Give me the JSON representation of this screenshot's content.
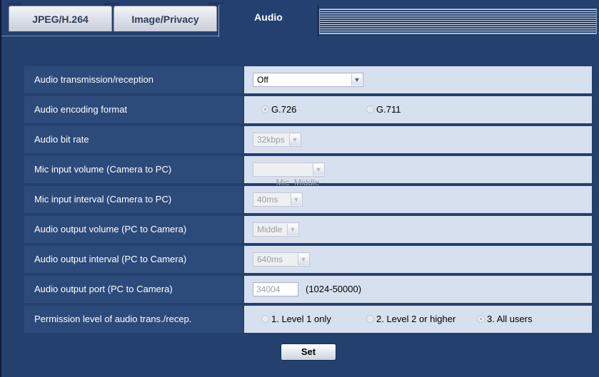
{
  "tabs": [
    {
      "label": "JPEG/H.264"
    },
    {
      "label": "Image/Privacy"
    },
    {
      "label": "Audio"
    }
  ],
  "rows": {
    "transmission": {
      "label": "Audio transmission/reception",
      "value": "Off"
    },
    "encoding": {
      "label": "Audio encoding format",
      "options": [
        "G.726",
        "G.711"
      ],
      "selected": "G.726"
    },
    "bitrate": {
      "label": "Audio bit rate",
      "value": "32kbps"
    },
    "mic_volume": {
      "label": "Mic input volume (Camera to PC)",
      "value": "Mic  Middle"
    },
    "mic_interval": {
      "label": "Mic input interval (Camera to PC)",
      "value": "40ms"
    },
    "out_volume": {
      "label": "Audio output volume (PC to Camera)",
      "value": "Middle"
    },
    "out_interval": {
      "label": "Audio output interval (PC to Camera)",
      "value": "640ms"
    },
    "out_port": {
      "label": "Audio output port (PC to Camera)",
      "value": "34004",
      "range": "(1024-50000)"
    },
    "permission": {
      "label": "Permission level of audio trans./recep.",
      "options": [
        "1. Level 1 only",
        "2. Level 2 or higher",
        "3. All users"
      ],
      "selected": "3. All users"
    }
  },
  "buttons": {
    "set": "Set"
  },
  "icons": {
    "dropdown": "chevron-down-icon",
    "radio": "radio-icon"
  },
  "colors": {
    "background": "#23406f",
    "label_cell": "#2c4b7b",
    "value_cell": "#d7e0ee",
    "tab_text": "#2c3d5c"
  }
}
